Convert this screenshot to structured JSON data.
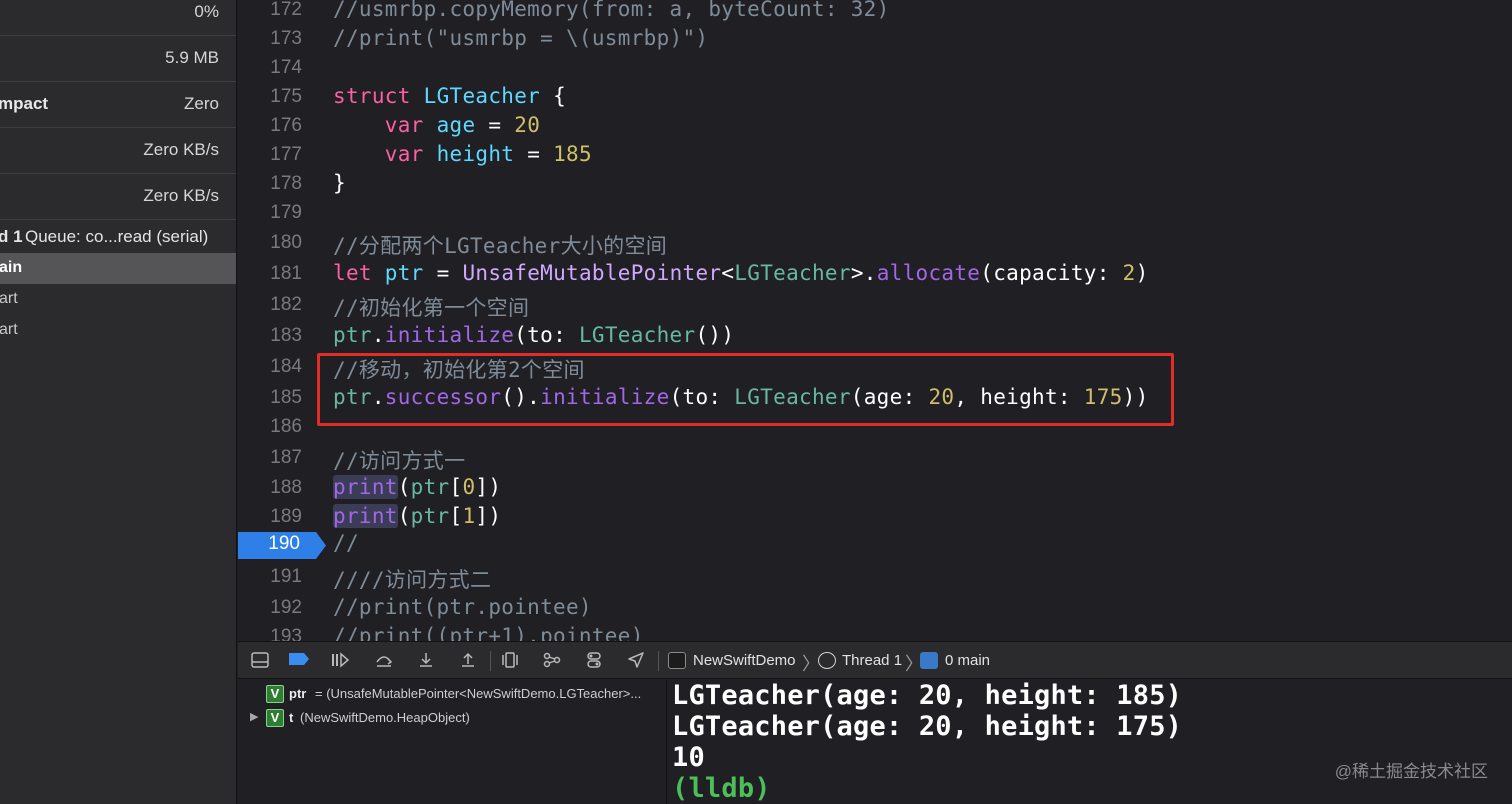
{
  "navigator": {
    "gauges": [
      {
        "label": "",
        "value": "0%"
      },
      {
        "label": "",
        "value": "5.9 MB"
      },
      {
        "label": "mpact",
        "value": "Zero"
      },
      {
        "label": "",
        "value": "Zero KB/s"
      },
      {
        "label": "",
        "value": "Zero KB/s"
      }
    ],
    "thread": {
      "name": "d 1",
      "queue": "Queue: co...read (serial)"
    },
    "frames": [
      {
        "label": "ain",
        "selected": true
      },
      {
        "label": "art",
        "selected": false
      },
      {
        "label": "art",
        "selected": false
      }
    ]
  },
  "editor": {
    "current_line": "190",
    "lines": [
      {
        "n": "172",
        "code": "//usmrbp.copyMemory(from: a, byteCount: 32)"
      },
      {
        "n": "173",
        "code": "//print(\"usmrbp = \\(usmrbp)\")"
      },
      {
        "n": "174",
        "code": ""
      },
      {
        "n": "175",
        "code": "struct LGTeacher {"
      },
      {
        "n": "176",
        "code": "    var age = 20"
      },
      {
        "n": "177",
        "code": "    var height = 185"
      },
      {
        "n": "178",
        "code": "}"
      },
      {
        "n": "179",
        "code": ""
      },
      {
        "n": "180",
        "code": "//分配两个LGTeacher大小的空间"
      },
      {
        "n": "181",
        "code": "let ptr = UnsafeMutablePointer<LGTeacher>.allocate(capacity: 2)"
      },
      {
        "n": "182",
        "code": "//初始化第一个空间"
      },
      {
        "n": "183",
        "code": "ptr.initialize(to: LGTeacher())"
      },
      {
        "n": "184",
        "code": "//移动，初始化第2个空间"
      },
      {
        "n": "185",
        "code": "ptr.successor().initialize(to: LGTeacher(age: 20, height: 175))"
      },
      {
        "n": "186",
        "code": ""
      },
      {
        "n": "187",
        "code": "//访问方式一"
      },
      {
        "n": "188",
        "code": "print(ptr[0])"
      },
      {
        "n": "189",
        "code": "print(ptr[1])"
      },
      {
        "n": "190",
        "code": "//"
      },
      {
        "n": "191",
        "code": "////访问方式二"
      },
      {
        "n": "192",
        "code": "//print(ptr.pointee)"
      },
      {
        "n": "193",
        "code": "//print((ptr+1).pointee)"
      }
    ]
  },
  "debugbar": {
    "crumbs": [
      "NewSwiftDemo",
      "Thread 1",
      "0 main"
    ]
  },
  "variables": [
    {
      "badge": "V",
      "name": "ptr",
      "value": "= (UnsafeMutablePointer<NewSwiftDemo.LGTeacher>...",
      "expandable": false
    },
    {
      "badge": "V",
      "name": "t",
      "value": "(NewSwiftDemo.HeapObject)",
      "expandable": true
    }
  ],
  "console": {
    "lines": [
      "LGTeacher(age: 20, height: 185)",
      "LGTeacher(age: 20, height: 175)",
      "10"
    ],
    "prompt": "(lldb)"
  },
  "watermark": "@稀土掘金技术社区",
  "colors": {
    "keyword": "#fc5fa3",
    "type": "#5dd8ff",
    "number": "#d0bf69",
    "comment": "#7f8c98",
    "current_line": "#2f7fe8",
    "highlight_box": "#e12d26",
    "lldb_prompt": "#4dbf5a"
  }
}
